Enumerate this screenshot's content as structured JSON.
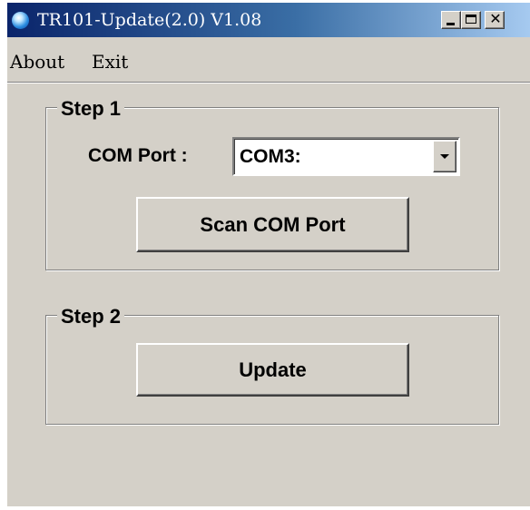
{
  "window": {
    "title": "TR101-Update(2.0) V1.08",
    "title_bar_buttons": [
      "minimize",
      "maximize",
      "close"
    ]
  },
  "menu": {
    "items": [
      {
        "label": "About"
      },
      {
        "label": "Exit"
      }
    ]
  },
  "step1": {
    "label": "Step 1",
    "com_port_label": "COM Port :",
    "com_port_value": "COM3:",
    "scan_button_label": "Scan COM Port"
  },
  "step2": {
    "label": "Step 2",
    "update_button_label": "Update"
  },
  "icons": {
    "app_icon": "app-orb-icon",
    "minimize": "minimize-icon",
    "maximize": "maximize-icon",
    "close": "close-icon",
    "dropdown": "chevron-down-icon"
  },
  "colors": {
    "titlebar_start": "#0a246a",
    "titlebar_end": "#a6caf0",
    "window_bg": "#d4d0c8"
  }
}
